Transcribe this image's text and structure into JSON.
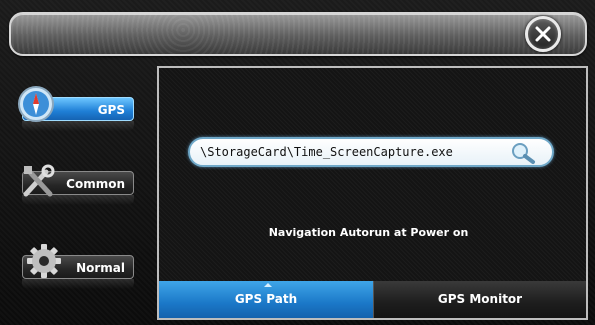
{
  "window": {
    "close_icon": "close-icon"
  },
  "sidebar": {
    "items": [
      {
        "label": "GPS",
        "icon": "compass-icon",
        "active": true
      },
      {
        "label": "Common",
        "icon": "tools-icon",
        "active": false
      },
      {
        "label": "Normal",
        "icon": "gear-icon",
        "active": false
      }
    ]
  },
  "main": {
    "path_value": "\\StorageCard\\Time_ScreenCapture.exe",
    "search_icon": "magnifier-icon",
    "autorun_label": "Navigation Autorun at Power on",
    "tabs": [
      {
        "label": "GPS Path",
        "active": true
      },
      {
        "label": "GPS Monitor",
        "active": false
      }
    ]
  },
  "colors": {
    "accent": "#1f7fd6",
    "panel_border": "#bdbdbd"
  }
}
